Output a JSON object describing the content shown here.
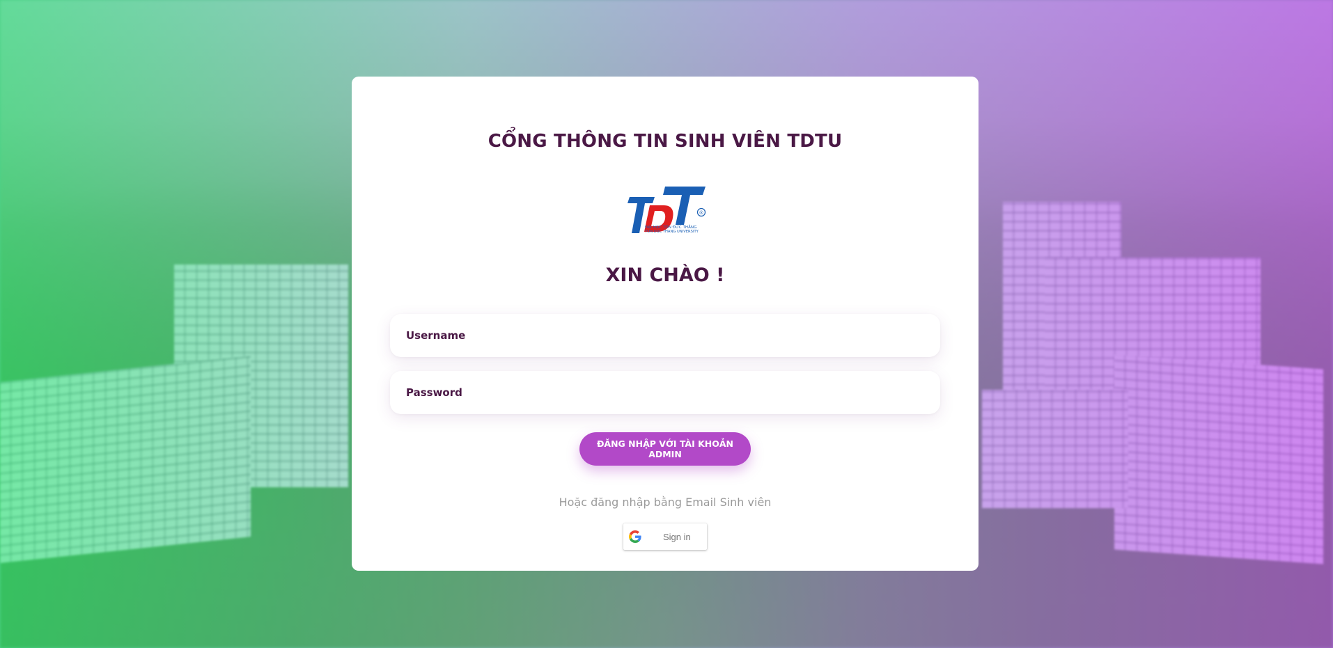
{
  "page": {
    "portal_title": "CỔNG THÔNG TIN SINH VIÊN TDTU",
    "greeting": "XIN CHÀO !"
  },
  "logo": {
    "mark": "TDT",
    "registered": "®",
    "line1": "ĐẠI HỌC TÔN ĐỨC THẮNG",
    "line2": "TON DUC THANG UNIVERSITY"
  },
  "form": {
    "username_placeholder": "Username",
    "password_placeholder": "Password",
    "admin_login_label": "ĐĂNG NHẬP VỚI TÀI KHOẢN ADMIN",
    "alt_login_text": "Hoặc đăng nhập bằng Email Sinh viên",
    "google_signin_label": "Sign in"
  },
  "icons": {
    "google": "google-g-icon"
  },
  "colors": {
    "title": "#4a1845",
    "accent_button": "#b249c8",
    "logo_blue": "#1a5fb4",
    "logo_red": "#e02020"
  }
}
